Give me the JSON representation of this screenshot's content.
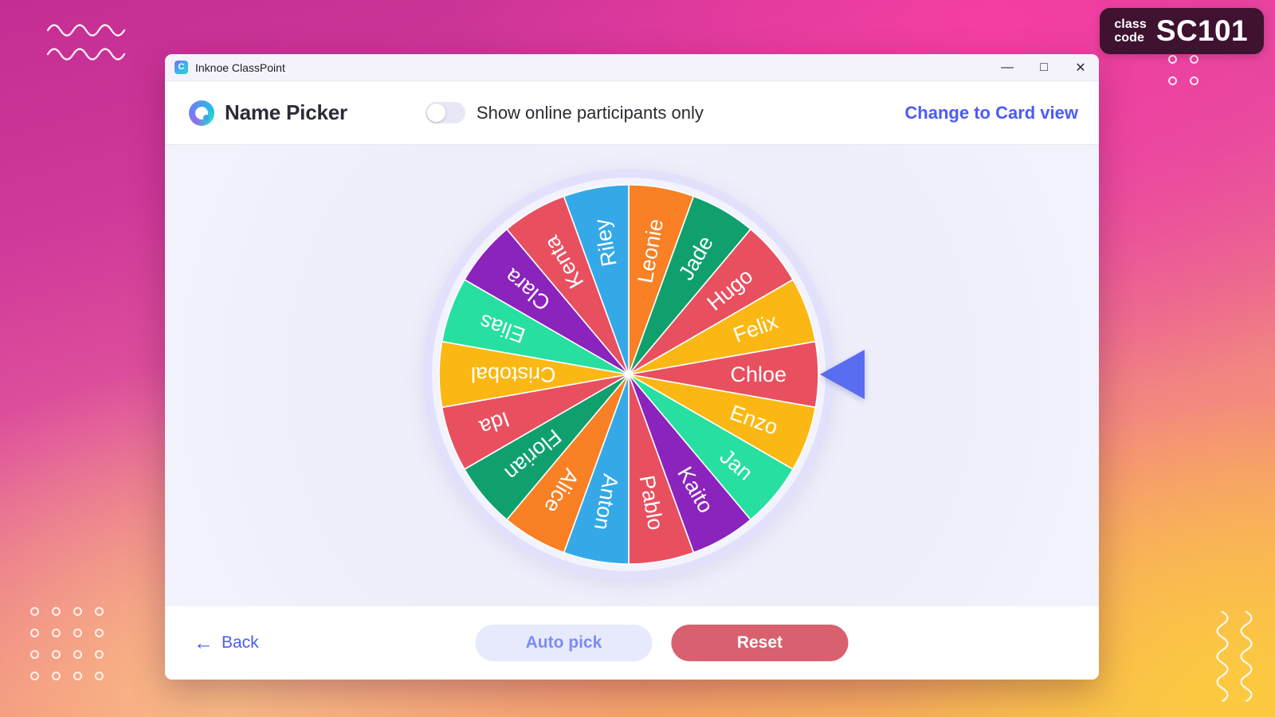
{
  "class_code": {
    "label_line1": "class",
    "label_line2": "code",
    "value": "SC101"
  },
  "window": {
    "app_icon": "classpoint-logo-icon",
    "title": "Inknoe ClassPoint",
    "controls": {
      "minimize": "—",
      "maximize": "□",
      "close": "✕"
    }
  },
  "header": {
    "logo": "name-picker-logo-icon",
    "title": "Name Picker",
    "toggle": {
      "label": "Show online participants only",
      "state": "off"
    },
    "change_view_link": "Change to Card view"
  },
  "footer": {
    "back_arrow": "←",
    "back_label": "Back",
    "auto_pick_label": "Auto pick",
    "reset_label": "Reset"
  },
  "colors": {
    "accent_blue": "#4a5bfa",
    "pointer": "#5a6cf0",
    "reset_red": "#d9606f",
    "auto_pick_bg": "#e6eafc",
    "wheel_ring": "#e2e1fb",
    "stage_bg": "#f1f1fb",
    "badge_bg": "#3f1230",
    "palette": {
      "orange": "#f98024",
      "green": "#0fa06e",
      "red": "#e8505f",
      "yellow": "#fbb814",
      "teal": "#27dfa0",
      "purple": "#8b23bd",
      "blue": "#35a9e8"
    }
  },
  "chart_data": {
    "type": "pie",
    "title": "Name Picker Wheel",
    "segment_count": 18,
    "segment_angle_deg": 20,
    "start_angle_deg": 0,
    "direction": "clockwise",
    "pointer_position": "right",
    "pointer_target": "Chloe",
    "categories": [
      "Leonie",
      "Jade",
      "Hugo",
      "Felix",
      "Chloe",
      "Enzo",
      "Jan",
      "Kaito",
      "Pablo",
      "Anton",
      "Alice",
      "Florian",
      "Ida",
      "Cristobal",
      "Elias",
      "Clara",
      "Kenta",
      "Riley"
    ],
    "values": [
      20,
      20,
      20,
      20,
      20,
      20,
      20,
      20,
      20,
      20,
      20,
      20,
      20,
      20,
      20,
      20,
      20,
      20
    ],
    "segments": [
      {
        "label": "Leonie",
        "color": "#f98024"
      },
      {
        "label": "Jade",
        "color": "#0fa06e"
      },
      {
        "label": "Hugo",
        "color": "#e8505f"
      },
      {
        "label": "Felix",
        "color": "#fbb814"
      },
      {
        "label": "Chloe",
        "color": "#e8505f"
      },
      {
        "label": "Enzo",
        "color": "#fbb814"
      },
      {
        "label": "Jan",
        "color": "#27dfa0"
      },
      {
        "label": "Kaito",
        "color": "#8b23bd"
      },
      {
        "label": "Pablo",
        "color": "#e8505f"
      },
      {
        "label": "Anton",
        "color": "#35a9e8"
      },
      {
        "label": "Alice",
        "color": "#f98024"
      },
      {
        "label": "Florian",
        "color": "#0fa06e"
      },
      {
        "label": "Ida",
        "color": "#e8505f"
      },
      {
        "label": "Cristobal",
        "color": "#fbb814"
      },
      {
        "label": "Elias",
        "color": "#27dfa0"
      },
      {
        "label": "Clara",
        "color": "#8b23bd"
      },
      {
        "label": "Kenta",
        "color": "#e8505f"
      },
      {
        "label": "Riley",
        "color": "#35a9e8"
      }
    ]
  }
}
